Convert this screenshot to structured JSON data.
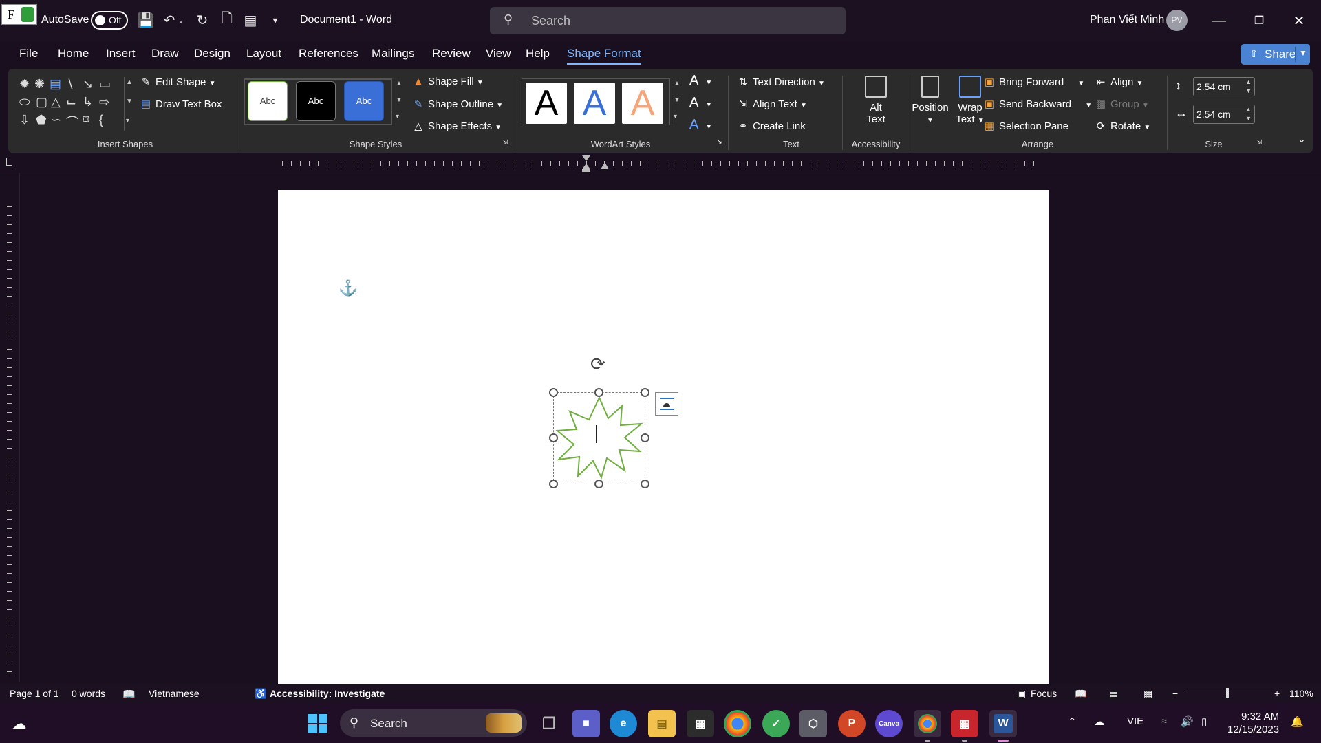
{
  "titlebar": {
    "autosave_label": "AutoSave",
    "autosave_state": "Off",
    "doc_title": "Document1  -  Word",
    "search_placeholder": "Search",
    "user_name": "Phan Viết Minh",
    "user_initials": "PV"
  },
  "tabs": [
    "File",
    "Home",
    "Insert",
    "Draw",
    "Design",
    "Layout",
    "References",
    "Mailings",
    "Review",
    "View",
    "Help",
    "Shape Format"
  ],
  "active_tab": "Shape Format",
  "share_label": "Share",
  "ribbon": {
    "insert_shapes": {
      "label": "Insert Shapes",
      "edit_shape": "Edit Shape",
      "draw_text_box": "Draw Text Box"
    },
    "shape_styles": {
      "label": "Shape Styles",
      "style_samples": [
        "Abc",
        "Abc",
        "Abc"
      ],
      "shape_fill": "Shape Fill",
      "shape_outline": "Shape Outline",
      "shape_effects": "Shape Effects"
    },
    "wordart_styles": {
      "label": "WordArt Styles",
      "samples": [
        "A",
        "A",
        "A"
      ],
      "sample_colors": [
        "#000000",
        "#3a6fd8",
        "#f4a67a"
      ]
    },
    "text": {
      "label": "Text",
      "text_direction": "Text Direction",
      "align_text": "Align Text",
      "create_link": "Create Link"
    },
    "accessibility": {
      "label": "Accessibility",
      "alt_text_line1": "Alt",
      "alt_text_line2": "Text"
    },
    "arrange": {
      "label": "Arrange",
      "position": "Position",
      "wrap_text_line1": "Wrap",
      "wrap_text_line2": "Text",
      "bring_forward": "Bring Forward",
      "send_backward": "Send Backward",
      "selection_pane": "Selection Pane",
      "align": "Align",
      "group": "Group",
      "rotate": "Rotate"
    },
    "size": {
      "label": "Size",
      "height": "2.54 cm",
      "width": "2.54 cm"
    }
  },
  "status": {
    "page": "Page 1 of 1",
    "words": "0 words",
    "language": "Vietnamese",
    "accessibility": "Accessibility: Investigate",
    "focus": "Focus",
    "zoom": "110%"
  },
  "taskbar": {
    "search_placeholder": "Search",
    "language": "VIE",
    "time": "9:32 AM",
    "date": "12/15/2023"
  },
  "colors": {
    "accent": "#7eb6ff",
    "share": "#4a83d4",
    "star_outline": "#6fae3f"
  }
}
